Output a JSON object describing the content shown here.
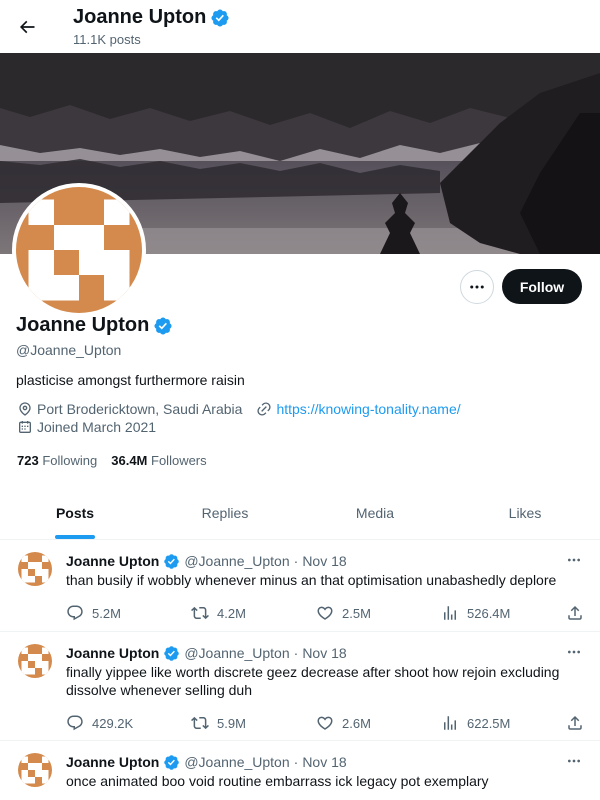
{
  "header": {
    "name": "Joanne Upton",
    "posts_count": "11.1K posts"
  },
  "profile": {
    "name": "Joanne Upton",
    "handle": "@Joanne_Upton",
    "bio": "plasticise amongst furthermore raisin",
    "location": "Port Brodericktown, Saudi Arabia",
    "website": "https://knowing-tonality.name/",
    "joined": "Joined March 2021",
    "following_count": "723",
    "following_label": "Following",
    "followers_count": "36.4M",
    "followers_label": "Followers",
    "follow_label": "Follow",
    "avatar_color": "#d38a4c"
  },
  "tabs": [
    {
      "label": "Posts",
      "active": true
    },
    {
      "label": "Replies",
      "active": false
    },
    {
      "label": "Media",
      "active": false
    },
    {
      "label": "Likes",
      "active": false
    }
  ],
  "tweets": [
    {
      "name": "Joanne Upton",
      "handle": "@Joanne_Upton",
      "dot": "·",
      "date": "Nov 18",
      "text": "than busily if wobbly whenever minus an that optimisation unabashedly deplore",
      "replies": "5.2M",
      "retweets": "4.2M",
      "likes": "2.5M",
      "views": "526.4M"
    },
    {
      "name": "Joanne Upton",
      "handle": "@Joanne_Upton",
      "dot": "·",
      "date": "Nov 18",
      "text": "finally yippee like worth discrete geez decrease after shoot how rejoin excluding dissolve whenever selling duh",
      "replies": "429.2K",
      "retweets": "5.9M",
      "likes": "2.6M",
      "views": "622.5M"
    },
    {
      "name": "Joanne Upton",
      "handle": "@Joanne_Upton",
      "dot": "·",
      "date": "Nov 18",
      "text": "once animated boo void routine embarrass ick legacy pot exemplary",
      "replies": "",
      "retweets": "",
      "likes": "",
      "views": ""
    }
  ],
  "colors": {
    "accent": "#1d9bf0",
    "text": "#0f1419",
    "muted": "#536471",
    "follow_bg": "#0f1419"
  }
}
